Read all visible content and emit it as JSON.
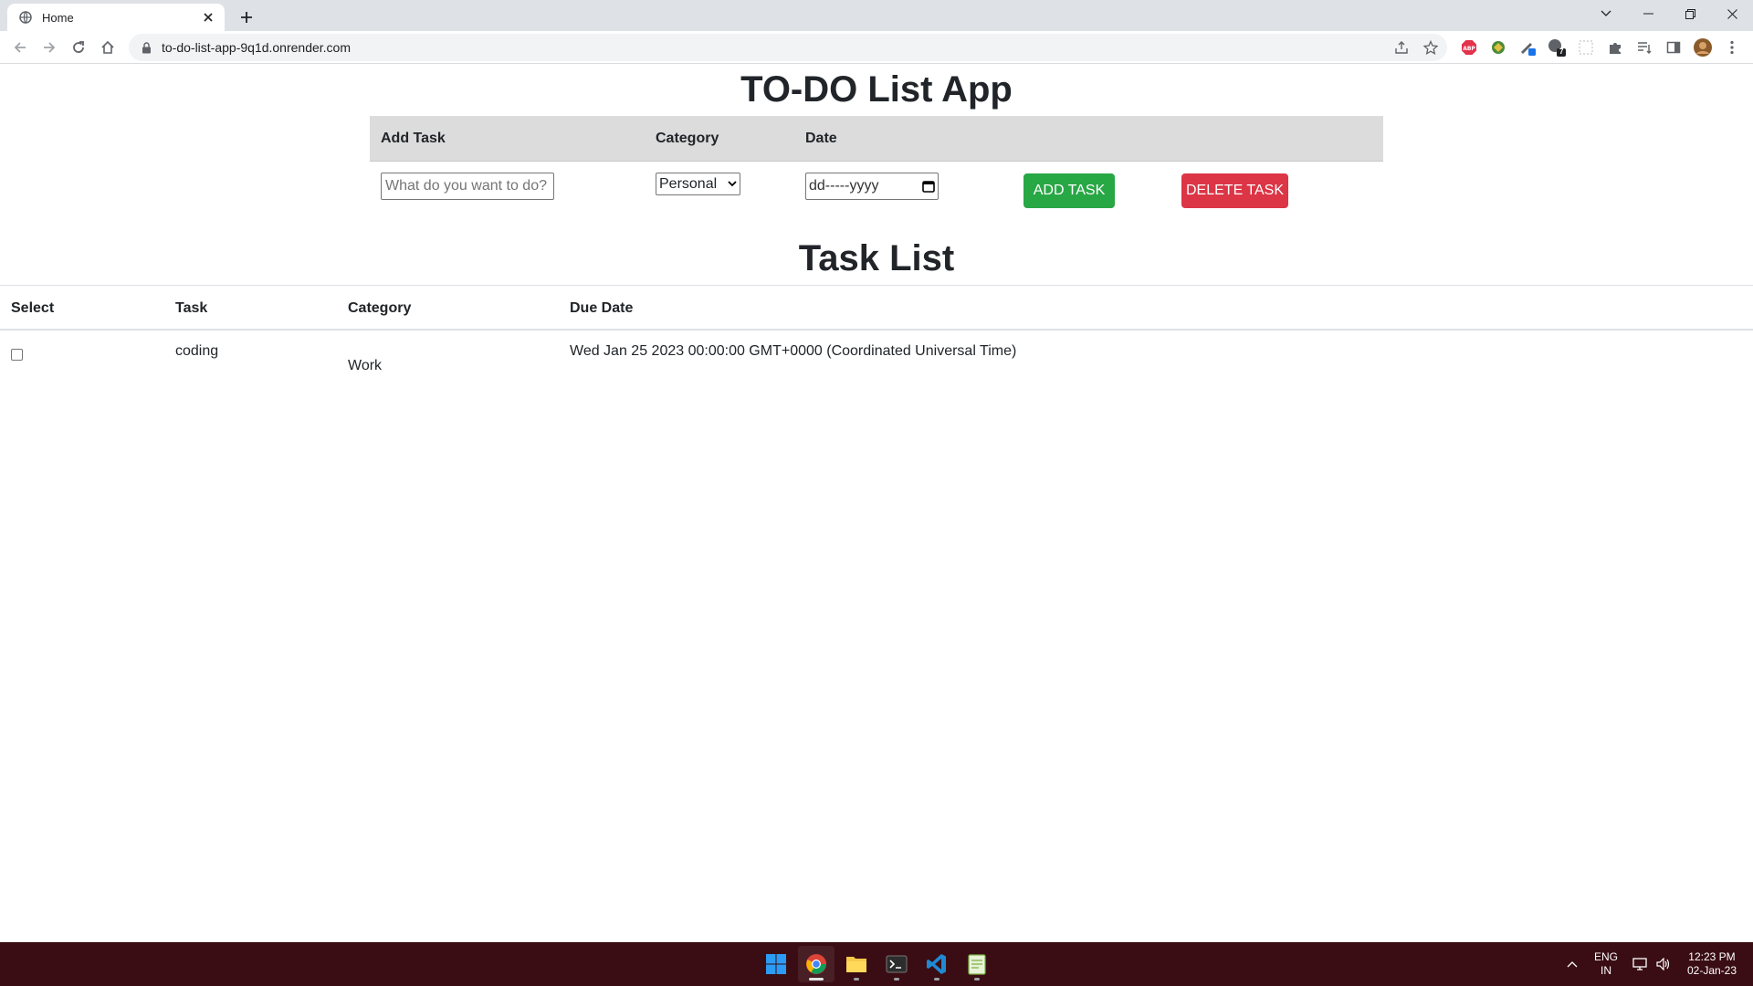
{
  "browser": {
    "tab_title": "Home",
    "url": "to-do-list-app-9q1d.onrender.com",
    "extensions": [
      "abp-icon",
      "extension-icon",
      "extension-icon",
      "extension-icon",
      "extension-icon",
      "puzzle-icon",
      "reading-list-icon",
      "side-panel-icon",
      "profile-avatar",
      "menu-icon"
    ],
    "ext_badge": "7"
  },
  "app": {
    "title": "TO-DO List App",
    "add_section": {
      "col_task": "Add Task",
      "col_category": "Category",
      "col_date": "Date",
      "task_placeholder": "What do you want to do?",
      "category_selected": "Personal",
      "date_placeholder": "dd-----yyyy",
      "add_button": "ADD TASK",
      "delete_button": "DELETE TASK"
    },
    "list_title": "Task List",
    "list_headers": {
      "select": "Select",
      "task": "Task",
      "category": "Category",
      "due_date": "Due Date"
    },
    "tasks": [
      {
        "checked": false,
        "task": "coding",
        "category": "Work",
        "due_date": "Wed Jan 25 2023 00:00:00 GMT+0000 (Coordinated Universal Time)"
      }
    ]
  },
  "taskbar": {
    "apps": [
      "start-icon",
      "chrome-icon",
      "file-explorer-icon",
      "terminal-icon",
      "vscode-icon",
      "notepad-icon"
    ],
    "lang_1": "ENG",
    "lang_2": "IN",
    "time": "12:23 PM",
    "date": "02-Jan-23"
  },
  "colors": {
    "add_button": "#28a745",
    "delete_button": "#dc3545",
    "taskbar": "#3a0d14",
    "header_bg": "#dcdcdc"
  }
}
